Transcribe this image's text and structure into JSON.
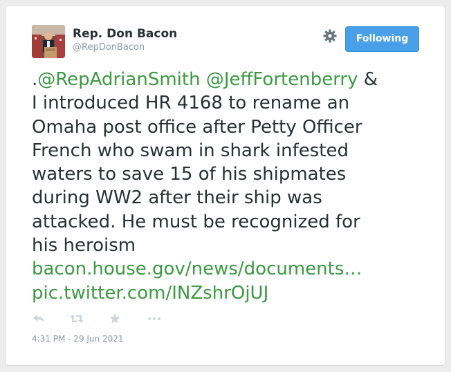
{
  "author": {
    "name": "Rep. Don Bacon",
    "handle": "@RepDonBacon"
  },
  "follow_button": {
    "label": "Following"
  },
  "icons": {
    "settings": "gear-icon",
    "reply": "reply-icon",
    "retweet": "retweet-icon",
    "favorite": "star-icon",
    "more": "more-icon"
  },
  "tweet": {
    "lines": [
      {
        "parts": [
          {
            "text": ".",
            "link": false
          },
          {
            "text": "@RepAdrianSmith",
            "link": true
          },
          {
            "text": " ",
            "link": false
          },
          {
            "text": "@JeffFortenberry",
            "link": true
          },
          {
            "text": " &",
            "link": false
          }
        ]
      },
      {
        "parts": [
          {
            "text": "I introduced HR 4168 to rename an",
            "link": false
          }
        ]
      },
      {
        "parts": [
          {
            "text": "Omaha post office after Petty Officer",
            "link": false
          }
        ]
      },
      {
        "parts": [
          {
            "text": "French who swam in shark infested",
            "link": false
          }
        ]
      },
      {
        "parts": [
          {
            "text": "waters to save 15 of his shipmates",
            "link": false
          }
        ]
      },
      {
        "parts": [
          {
            "text": "during WW2 after their ship was",
            "link": false
          }
        ]
      },
      {
        "parts": [
          {
            "text": "attacked. He must be recognized for",
            "link": false
          }
        ]
      },
      {
        "parts": [
          {
            "text": "his heroism",
            "link": false
          }
        ]
      },
      {
        "parts": [
          {
            "text": "bacon.house.gov/news/documents…",
            "link": true
          }
        ]
      },
      {
        "parts": [
          {
            "text": "pic.twitter.com/INZshrOjUJ",
            "link": true
          }
        ]
      }
    ],
    "timestamp": "4:31 PM - 29 Jun 2021"
  },
  "colors": {
    "link": "#3a9a40",
    "button": "#4aa0e8",
    "text": "#292f33",
    "muted": "#8899a6"
  }
}
